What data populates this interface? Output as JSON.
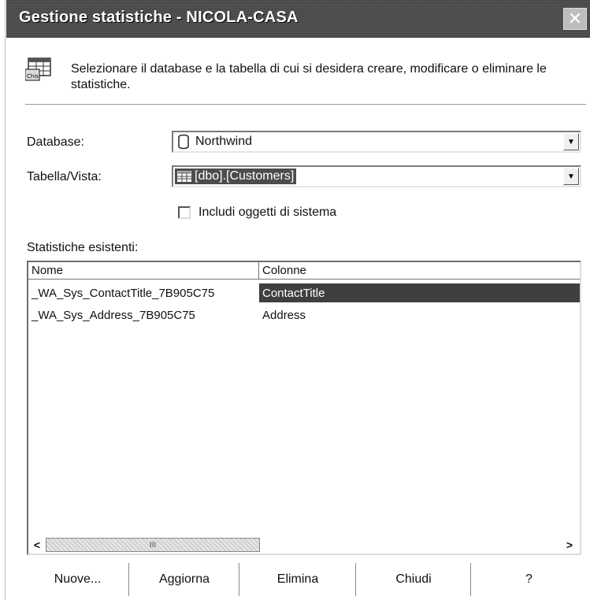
{
  "window": {
    "title": "Gestione statistiche - NICOLA-CASA",
    "close_icon": "close-icon"
  },
  "header": {
    "icon": "statistics-table-icon",
    "description": "Selezionare il database e la tabella di cui si desidera creare, modificare o eliminare le statistiche."
  },
  "form": {
    "database_label": "Database:",
    "database_value": "Northwind",
    "database_icon": "database-icon",
    "table_label": "Tabella/Vista:",
    "table_value": "[dbo].[Customers]",
    "table_icon": "table-icon",
    "include_system_label": "Includi oggetti di sistema",
    "include_system_checked": false
  },
  "statistics": {
    "label": "Statistiche esistenti:",
    "columns": [
      "Nome",
      "Colonne"
    ],
    "rows": [
      {
        "name": "_WA_Sys_ContactTitle_7B905C75",
        "columns": "ContactTitle",
        "selected": true
      },
      {
        "name": "_WA_Sys_Address_7B905C75",
        "columns": "Address",
        "selected": false
      }
    ],
    "scroll_thumb_label": "III"
  },
  "buttons": {
    "new": "Nuove...",
    "refresh": "Aggiorna",
    "delete": "Elimina",
    "close": "Chiudi",
    "help": "?"
  },
  "colors": {
    "titlebar": "#4a4a4a",
    "selection": "#3f3f3f"
  }
}
